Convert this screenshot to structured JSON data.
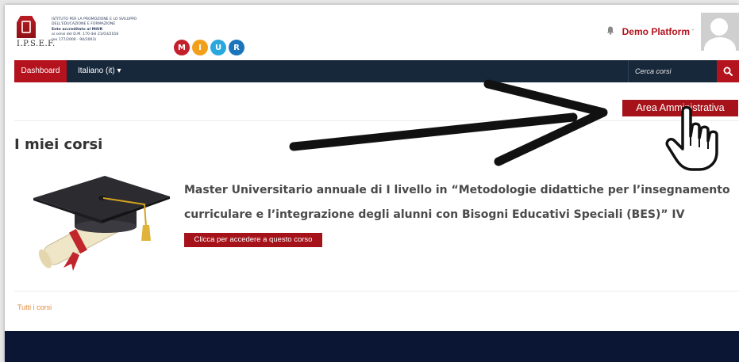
{
  "brand": {
    "acronym": "I.P.S.E.F.",
    "lines": [
      "ISTITUTO PER LA PROMOZIONE E LO SVILUPPO",
      "DELL'EDUCAZIONE E FORMAZIONE",
      "Ente accreditato al MIUR",
      "ai sensi del D.M. 170 del 21/03/2016",
      "(ex 177/2000 - 90/2003)"
    ],
    "miur_letters": [
      "M",
      "I",
      "U",
      "R"
    ],
    "miur_colors": [
      "#c31f2c",
      "#f2a01c",
      "#2aa8dd",
      "#1b75bb"
    ],
    "primary_color": "#b4121d"
  },
  "user": {
    "name": "Demo Platform",
    "caret": "˅"
  },
  "nav": {
    "dashboard": "Dashboard",
    "language": "Italiano (it) ▾",
    "search_placeholder": "Cerca corsi"
  },
  "admin_button": "Area Amministrativa",
  "page_title": "I miei corsi",
  "course": {
    "title": "Master Universitario annuale di I livello in “Metodologie didattiche per l’insegnamento curriculare e l’integrazione degli alunni con Bisogni Educativi Speciali (BES)” IV edizione",
    "button": "Clicca per accedere a questo corso",
    "image_icon": "graduation-cap-diploma"
  },
  "all_courses_link": "Tutti i corsi",
  "overlays": {
    "arrow": "black-arrow-icon",
    "cursor": "hand-pointer-icon"
  }
}
